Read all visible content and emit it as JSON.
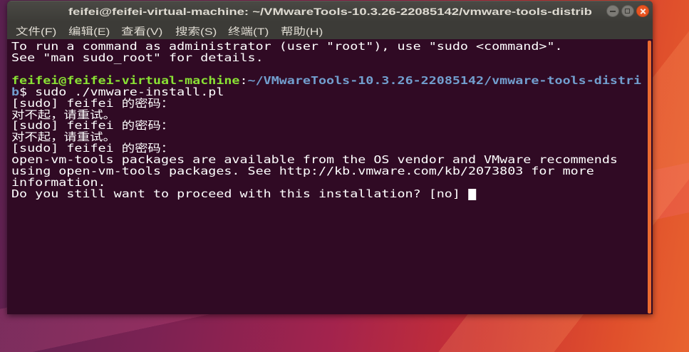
{
  "window": {
    "title": "feifei@feifei-virtual-machine: ~/VMwareTools-10.3.26-22085142/vmware-tools-distrib",
    "controls": {
      "minimize_icon": "minimize-icon",
      "maximize_icon": "maximize-icon",
      "close_icon": "close-icon"
    }
  },
  "menu": {
    "items": [
      {
        "label": "文件(F)"
      },
      {
        "label": "编辑(E)"
      },
      {
        "label": "查看(V)"
      },
      {
        "label": "搜索(S)"
      },
      {
        "label": "终端(T)"
      },
      {
        "label": "帮助(H)"
      }
    ]
  },
  "terminal": {
    "motd": [
      "To run a command as administrator (user \"root\"), use \"sudo <command>\".",
      "See \"man sudo_root\" for details."
    ],
    "prompt": {
      "user_host": "feifei@feifei-virtual-machine",
      "separator": ":",
      "path": "~/VMwareTools-10.3.26-22085142/vmware-tools-distrib",
      "symbol": "$ ",
      "command": "sudo ./vmware-install.pl"
    },
    "output": [
      "[sudo] feifei 的密码：",
      "对不起，请重试。",
      "[sudo] feifei 的密码：",
      "对不起，请重试。",
      "[sudo] feifei 的密码：",
      "open-vm-tools packages are available from the OS vendor and VMware recommends",
      "using open-vm-tools packages. See http://kb.vmware.com/kb/2073803 for more",
      "information."
    ],
    "question": "Do you still want to proceed with this installation? [no] "
  },
  "colors": {
    "desktop_purple": "#5a2150",
    "desktop_magenta": "#a3234d",
    "desktop_orange": "#e0502c",
    "titlebar": "#3c3b37",
    "title_text": "#dfdbd2",
    "terminal_background": "#300a24",
    "terminal_foreground": "#ffffff",
    "prompt_user_host": "#8ae234",
    "prompt_path": "#729fcf",
    "close_button": "#e95420",
    "window_button": "#7d7b76",
    "scrollbar": "#ec6a30"
  }
}
